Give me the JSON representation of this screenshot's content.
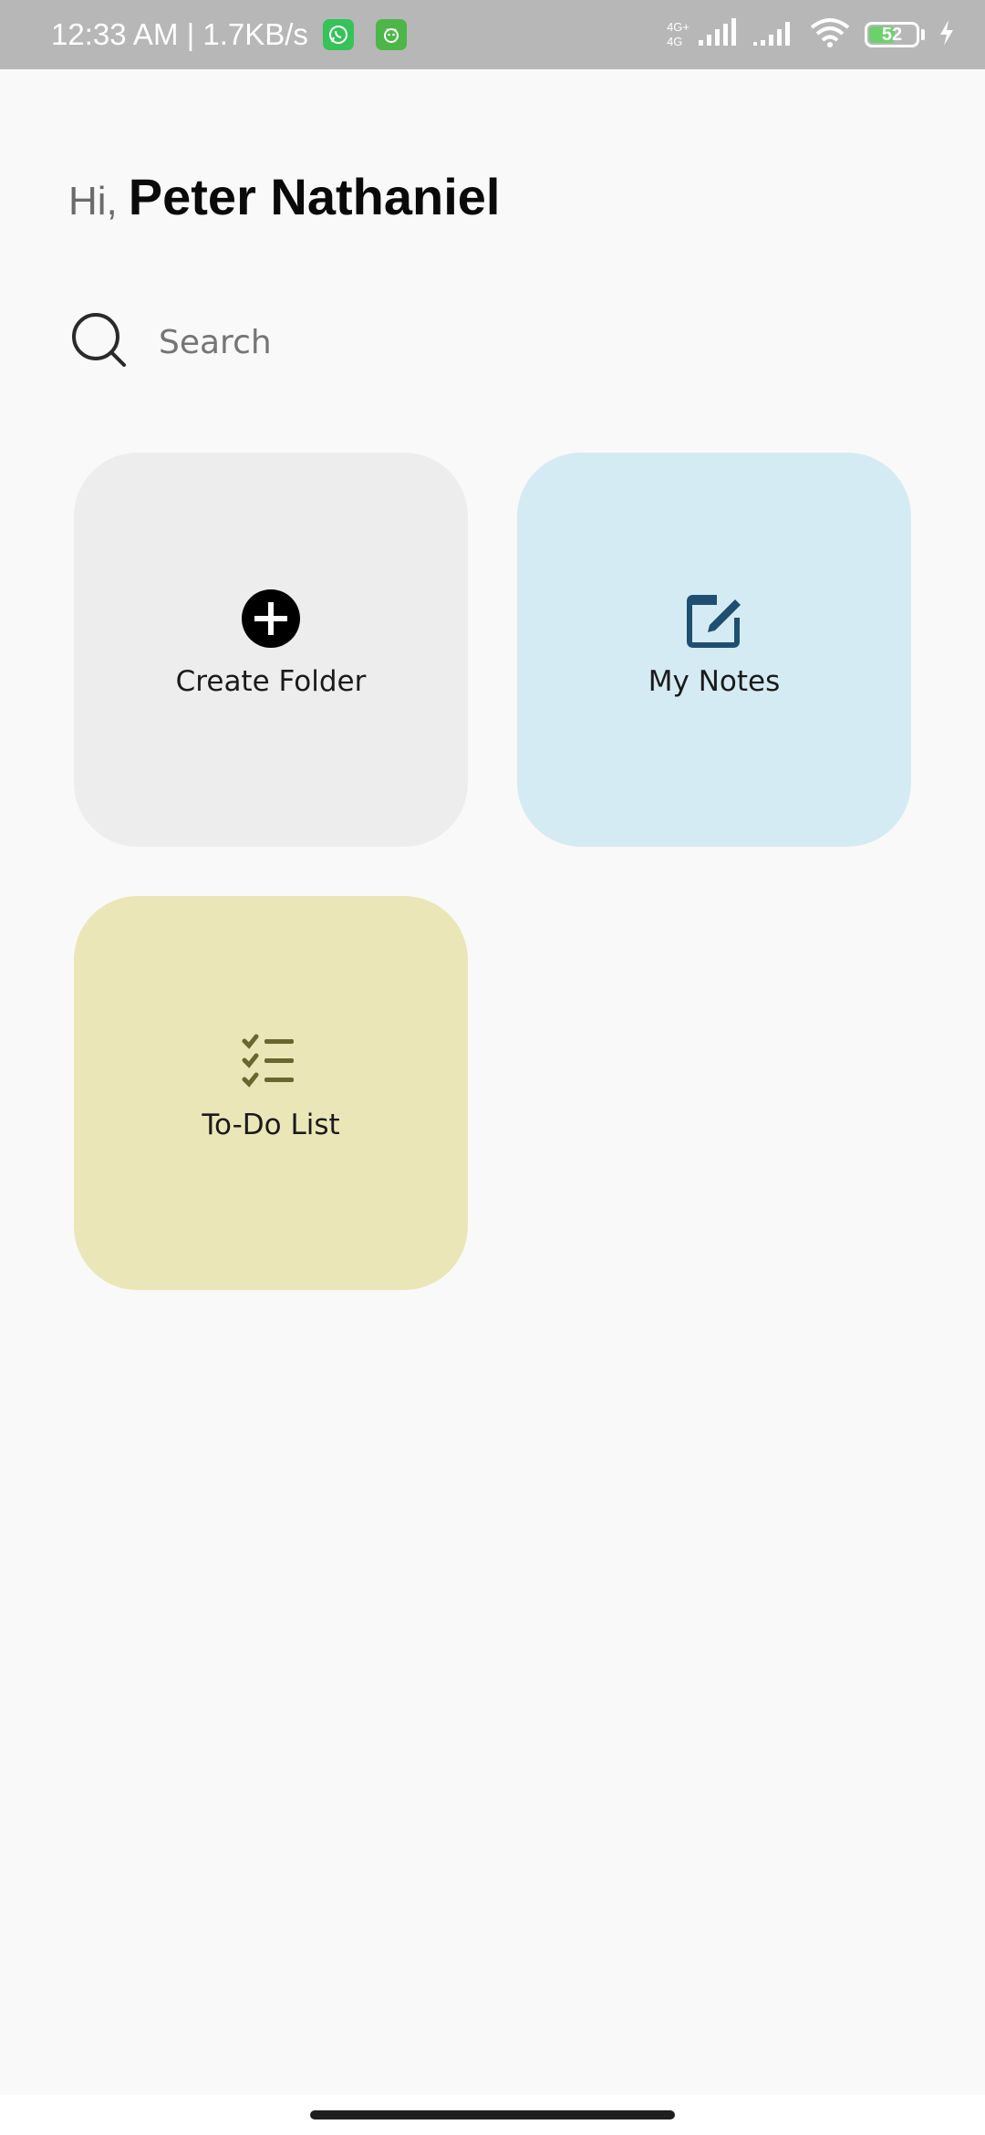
{
  "status_bar": {
    "time_speed": "12:33 AM | 1.7KB/s",
    "network_type": "4G+",
    "network_sub": "4G",
    "battery_level": "52",
    "battery_fraction": 0.52
  },
  "greeting": {
    "hi": "Hi,",
    "name": "Peter Nathaniel"
  },
  "search": {
    "placeholder": "Search"
  },
  "tiles": [
    {
      "label": "Create Folder",
      "icon": "add-circle-icon",
      "color": "#ededed"
    },
    {
      "label": "My Notes",
      "icon": "edit-note-icon",
      "color": "#d5ebf3"
    },
    {
      "label": "To-Do List",
      "icon": "checklist-icon",
      "color": "#ebe6b7"
    }
  ],
  "colors": {
    "background": "#f9f9f9",
    "status_bar": "#b7b7b7",
    "notes_icon": "#1e4f73",
    "todo_icon": "#6b6530"
  }
}
